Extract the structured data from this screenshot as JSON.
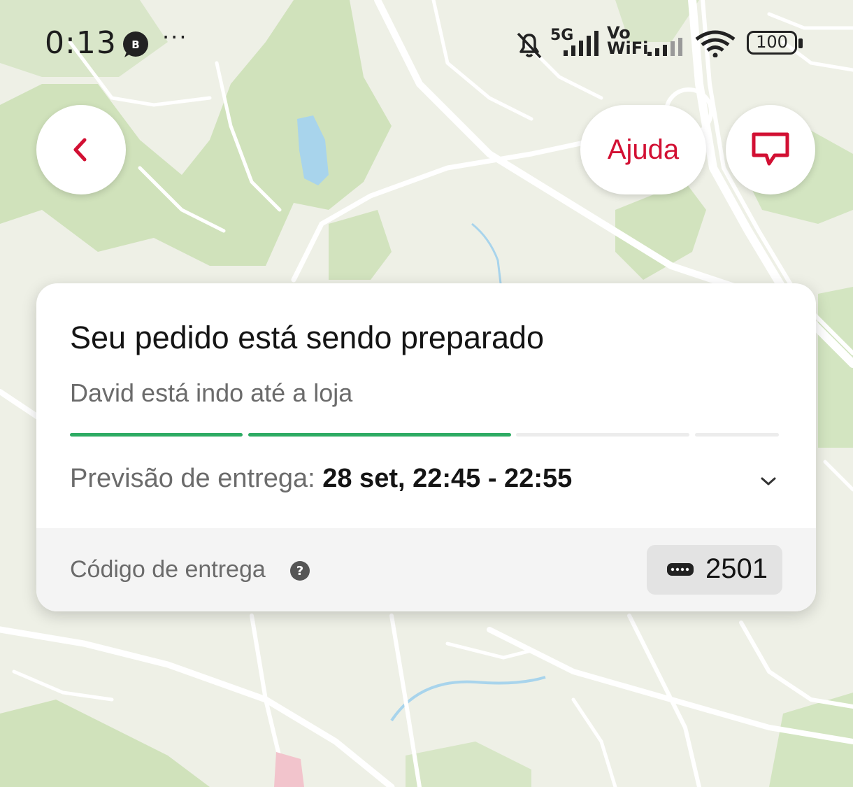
{
  "status_bar": {
    "time": "0:13",
    "app_icon": "whatsapp-business-icon",
    "more": "···",
    "network_label": "5G",
    "vowifi_line1": "Vo",
    "vowifi_line2": "WiFi",
    "battery": "100",
    "icons": [
      "silent-bell-icon",
      "signal-bars-icon",
      "wifi-icon",
      "battery-icon"
    ]
  },
  "header": {
    "back_icon": "chevron-left-icon",
    "help_label": "Ajuda",
    "chat_icon": "chat-bubble-icon"
  },
  "order_card": {
    "title": "Seu pedido está sendo preparado",
    "subtitle": "David está indo até a loja",
    "progress": {
      "segments": 4,
      "fill": [
        1.0,
        1.0,
        0.0,
        0.0
      ]
    },
    "eta_label": "Previsão de entrega: ",
    "eta_value": "28 set, 22:45 - 22:55",
    "expand_icon": "chevron-down-icon",
    "delivery_code_label": "Código de entrega",
    "delivery_code_help_icon": "question-circle-icon",
    "delivery_code": "2501",
    "delivery_code_icon": "password-dots-icon"
  },
  "colors": {
    "accent": "#d21033",
    "progress_active": "#2dab63",
    "progress_inactive": "#ececec",
    "map_land": "#eef0e6",
    "map_green": "#c8dfb0",
    "map_water": "#a8d4ec"
  }
}
